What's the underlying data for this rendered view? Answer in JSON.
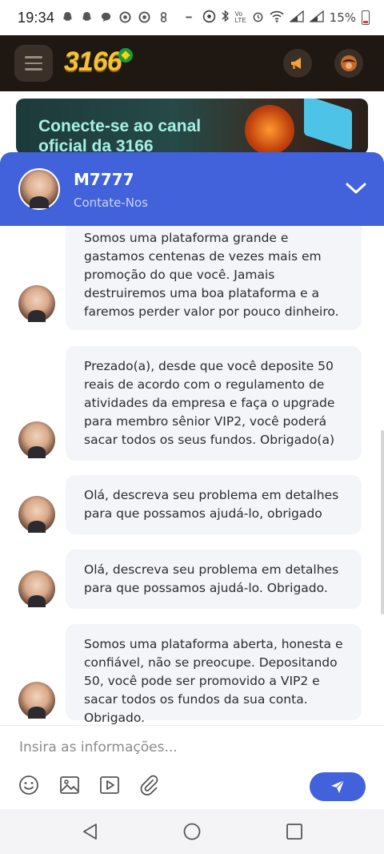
{
  "status_bar": {
    "time": "19:34",
    "battery": "15%",
    "notification_icons": [
      "snapchat-icon",
      "snapchat-icon",
      "chat-icon",
      "chrome-icon",
      "chrome-icon",
      "settings-icon",
      "minus-icon"
    ],
    "system_icons": [
      "sync-icon",
      "bluetooth-icon",
      "volte-icon",
      "alarm-icon",
      "wifi-icon",
      "signal-icon",
      "signal-icon",
      "battery-icon"
    ]
  },
  "app": {
    "logo_text": "3166",
    "buttons": [
      "menu-icon",
      "announcement-icon",
      "avatar-icon"
    ]
  },
  "banner": {
    "text_line1": "Conecte-se ao canal",
    "text_line2": "oficial da 3166"
  },
  "chat": {
    "agent_name": "M7777",
    "agent_subtitle": "Contate-Nos",
    "header_color": "#4262db",
    "messages": [
      {
        "text": "Somos uma plataforma grande e gastamos centenas de vezes mais em promoção do que você. Jamais destruiremos uma boa plataforma e a faremos perder valor por pouco dinheiro."
      },
      {
        "text": "Prezado(a), desde que você deposite 50 reais de acordo com o regulamento de atividades da empresa e faça o upgrade para membro sênior VIP2, você poderá sacar todos os seus fundos. Obrigado(a)"
      },
      {
        "text": "Olá, descreva seu problema em detalhes para que possamos ajudá-lo, obrigado"
      },
      {
        "text": "Olá, descreva seu problema em detalhes para que possamos ajudá-lo. Obrigado."
      },
      {
        "text": "Somos uma plataforma aberta, honesta e confiável, não se preocupe. Depositando 50, você pode ser promovido a VIP2 e sacar todos os fundos da sua conta. Obrigado."
      }
    ]
  },
  "input": {
    "placeholder": "Insira as informações...",
    "value": "",
    "tools": [
      "emoji-icon",
      "image-icon",
      "video-icon",
      "attachment-icon"
    ],
    "send_icon": "send-icon"
  },
  "nav": {
    "buttons": [
      "back-icon",
      "home-icon",
      "recents-icon"
    ]
  }
}
